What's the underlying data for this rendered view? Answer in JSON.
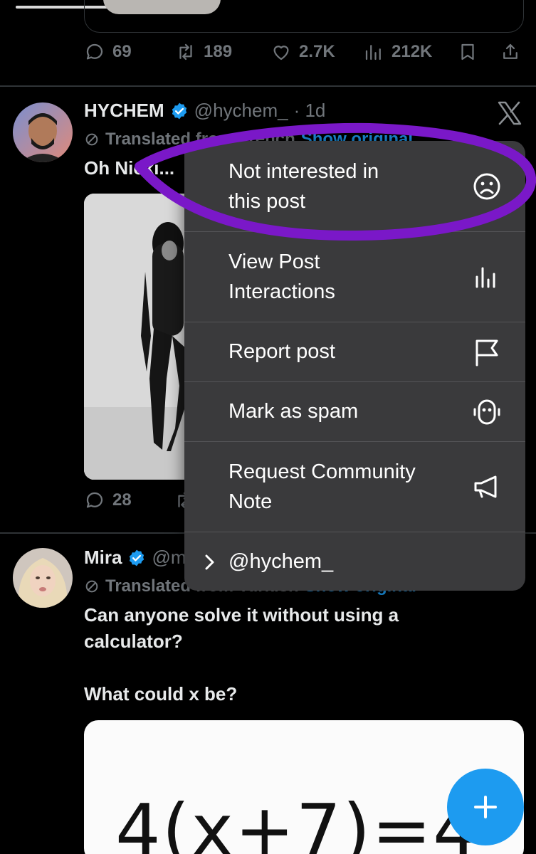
{
  "prev_post": {
    "stats": {
      "replies": "69",
      "reposts": "189",
      "likes": "2.7K",
      "views": "212K"
    }
  },
  "post1": {
    "display_name": "HYCHEM",
    "handle": "@hychem_",
    "time": "· 1d",
    "translated": "Translated from French",
    "show_original": "Show original",
    "text": "Oh Nicki...",
    "stats": {
      "replies": "28"
    }
  },
  "menu": {
    "items": [
      {
        "label_line1": "Not interested in",
        "label_line2": "this post",
        "icon": "frown-face-icon"
      },
      {
        "label_line1": "View Post",
        "label_line2": "Interactions",
        "icon": "bar-chart-icon"
      },
      {
        "label_line1": "Report post",
        "label_line2": "",
        "icon": "flag-icon"
      },
      {
        "label_line1": "Mark as spam",
        "label_line2": "",
        "icon": "robot-icon"
      },
      {
        "label_line1": "Request Community",
        "label_line2": "Note",
        "icon": "megaphone-icon"
      }
    ],
    "footer": "@hychem_",
    "highlight_color": "#7a18c8"
  },
  "post2": {
    "display_name": "Mira",
    "handle": "@m",
    "translated": "Translated from Turkish",
    "show_original": "Show original",
    "text_line1": "Can anyone solve it without using a",
    "text_line2": "calculator?",
    "text_line3": "What could x be?",
    "equation": "4(x+7)=4"
  },
  "colors": {
    "accent": "#1d9bf0",
    "background": "#000000",
    "menu_bg": "#3a3a3c"
  }
}
